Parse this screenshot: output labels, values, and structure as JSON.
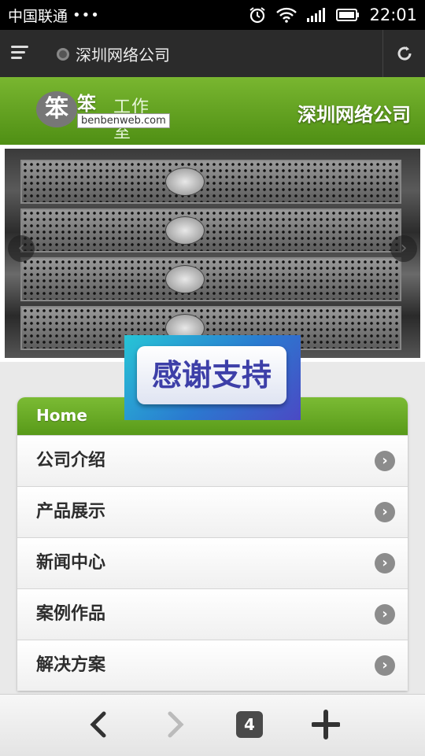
{
  "status_bar": {
    "carrier": "中国联通",
    "dots": "•••",
    "time": "22:01"
  },
  "browser": {
    "page_title": "深圳网络公司"
  },
  "site_header": {
    "logo_char": "笨",
    "logo_main": "笨",
    "logo_sub": "工作室",
    "logo_url": "benbenweb.com",
    "title": "深圳网络公司"
  },
  "slider": {
    "prev": "‹",
    "next": "›"
  },
  "banner": {
    "text": "感谢支持"
  },
  "nav": {
    "header": "Home",
    "items": [
      {
        "label": "公司介绍"
      },
      {
        "label": "产品展示"
      },
      {
        "label": "新闻中心"
      },
      {
        "label": "案例作品"
      },
      {
        "label": "解决方案"
      }
    ]
  },
  "bottom_bar": {
    "tab_count": "4"
  },
  "colors": {
    "accent_green": "#5a9b1a",
    "banner_blue": "#3d3fa8"
  }
}
